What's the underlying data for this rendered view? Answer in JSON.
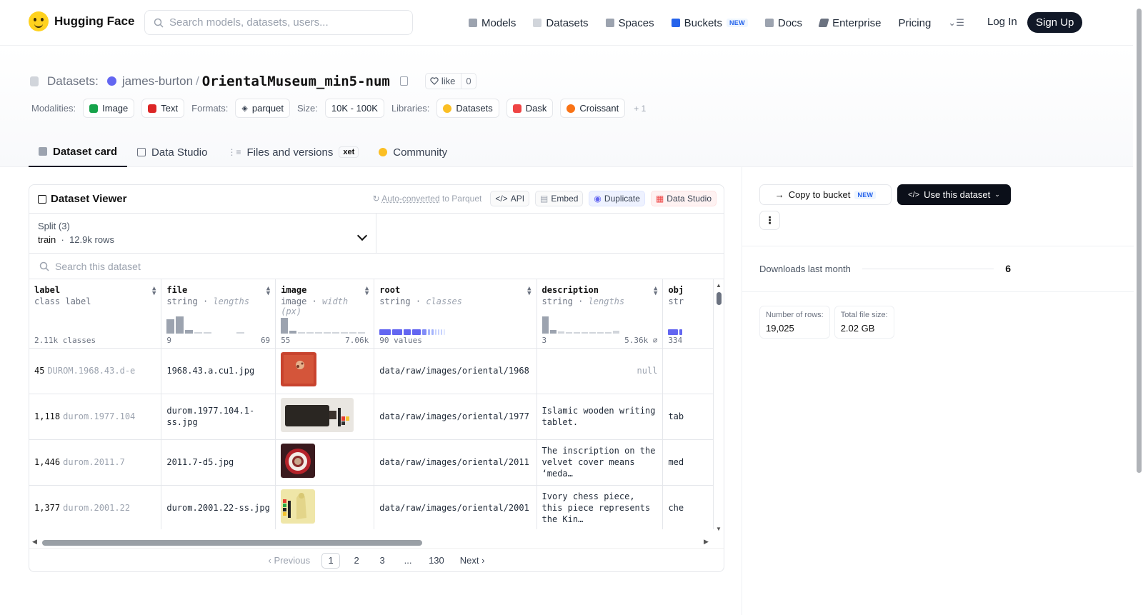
{
  "nav": {
    "brand": "Hugging Face",
    "search_placeholder": "Search models, datasets, users...",
    "links": [
      {
        "label": "Models",
        "icon": "models-icon",
        "color": "#9ca3af"
      },
      {
        "label": "Datasets",
        "icon": "datasets-icon",
        "color": "#d1d5db"
      },
      {
        "label": "Spaces",
        "icon": "spaces-icon",
        "color": "#9ca3af"
      },
      {
        "label": "Buckets",
        "icon": "buckets-icon",
        "color": "#2563eb",
        "badge": "NEW"
      },
      {
        "label": "Docs",
        "icon": "docs-icon",
        "color": "#9ca3af"
      },
      {
        "label": "Enterprise",
        "icon": "enterprise-icon",
        "color": "#6b7280"
      },
      {
        "label": "Pricing"
      }
    ],
    "login": "Log In",
    "signup": "Sign Up"
  },
  "header": {
    "crumb_label": "Datasets:",
    "owner": "james-burton",
    "separator": "/",
    "name": "OrientalMuseum_min5-num",
    "like_label": "like",
    "like_count": "0",
    "tags": {
      "modalities_label": "Modalities:",
      "modalities": [
        {
          "label": "Image",
          "color": "#16a34a"
        },
        {
          "label": "Text",
          "color": "#dc2626"
        }
      ],
      "formats_label": "Formats:",
      "formats": [
        "parquet"
      ],
      "size_label": "Size:",
      "size": "10K - 100K",
      "libraries_label": "Libraries:",
      "libraries": [
        {
          "label": "Datasets",
          "color": "#fbbf24"
        },
        {
          "label": "Dask",
          "color": "#ef4444"
        },
        {
          "label": "Croissant",
          "color": "#f97316"
        }
      ],
      "more": "+ 1"
    },
    "tabs": [
      {
        "label": "Dataset card",
        "active": true
      },
      {
        "label": "Data Studio"
      },
      {
        "label": "Files and versions",
        "badge": "xet"
      },
      {
        "label": "Community"
      }
    ]
  },
  "viewer": {
    "title": "Dataset Viewer",
    "auto_converted_link": "Auto-converted",
    "auto_converted_rest": " to Parquet",
    "buttons": {
      "api": "API",
      "embed": "Embed",
      "duplicate": "Duplicate",
      "studio": "Data Studio"
    },
    "split_label": "Split (3)",
    "split_value": "train",
    "split_rows": "12.9k rows",
    "search_placeholder": "Search this dataset",
    "columns": [
      {
        "name": "label",
        "type": "class label",
        "type_note": "",
        "footer_left": "2.11k classes",
        "footer_right": ""
      },
      {
        "name": "file",
        "type": "string",
        "type_note": "lengths",
        "footer_left": "9",
        "footer_right": "69"
      },
      {
        "name": "image",
        "type": "image",
        "type_note": "width (px)",
        "footer_left": "55",
        "footer_right": "7.06k"
      },
      {
        "name": "root",
        "type": "string",
        "type_note": "classes",
        "footer_left": "90 values",
        "footer_right": ""
      },
      {
        "name": "description",
        "type": "string",
        "type_note": "lengths",
        "footer_left": "3",
        "footer_right": "5.36k ⌀"
      },
      {
        "name": "obj",
        "type": "str",
        "type_note": "",
        "footer_left": "334",
        "footer_right": ""
      }
    ],
    "rows": [
      {
        "label_idx": "45",
        "label_name": "DUROM.1968.43.d-e",
        "file": "1968.43.a.cu1.jpg",
        "root": "data/raw/images/oriental/1968",
        "description": "",
        "description_null": "null",
        "obj": ""
      },
      {
        "label_idx": "1,118",
        "label_name": "durom.1977.104",
        "file": "durom.1977.104.1-ss.jpg",
        "root": "data/raw/images/oriental/1977",
        "description": "Islamic wooden writing tablet.",
        "description_null": "",
        "obj": "tab"
      },
      {
        "label_idx": "1,446",
        "label_name": "durom.2011.7",
        "file": "2011.7-d5.jpg",
        "root": "data/raw/images/oriental/2011",
        "description": "The inscription on the velvet cover means ‘meda…",
        "description_null": "",
        "obj": "med"
      },
      {
        "label_idx": "1,377",
        "label_name": "durom.2001.22",
        "file": "durom.2001.22-ss.jpg",
        "root": "data/raw/images/oriental/2001",
        "description": "Ivory chess piece, this piece represents the Kin…",
        "description_null": "",
        "obj": "che"
      }
    ],
    "pager": {
      "previous": "Previous",
      "pages": [
        "1",
        "2",
        "3",
        "...",
        "130"
      ],
      "current": "1",
      "next": "Next"
    }
  },
  "side": {
    "copy_bucket": "Copy to bucket",
    "copy_badge": "NEW",
    "use_dataset": "Use this dataset",
    "downloads_label": "Downloads last month",
    "downloads_value": "6",
    "rows_label": "Number of rows:",
    "rows_value": "19,025",
    "size_label": "Total file size:",
    "size_value": "2.02 GB"
  }
}
